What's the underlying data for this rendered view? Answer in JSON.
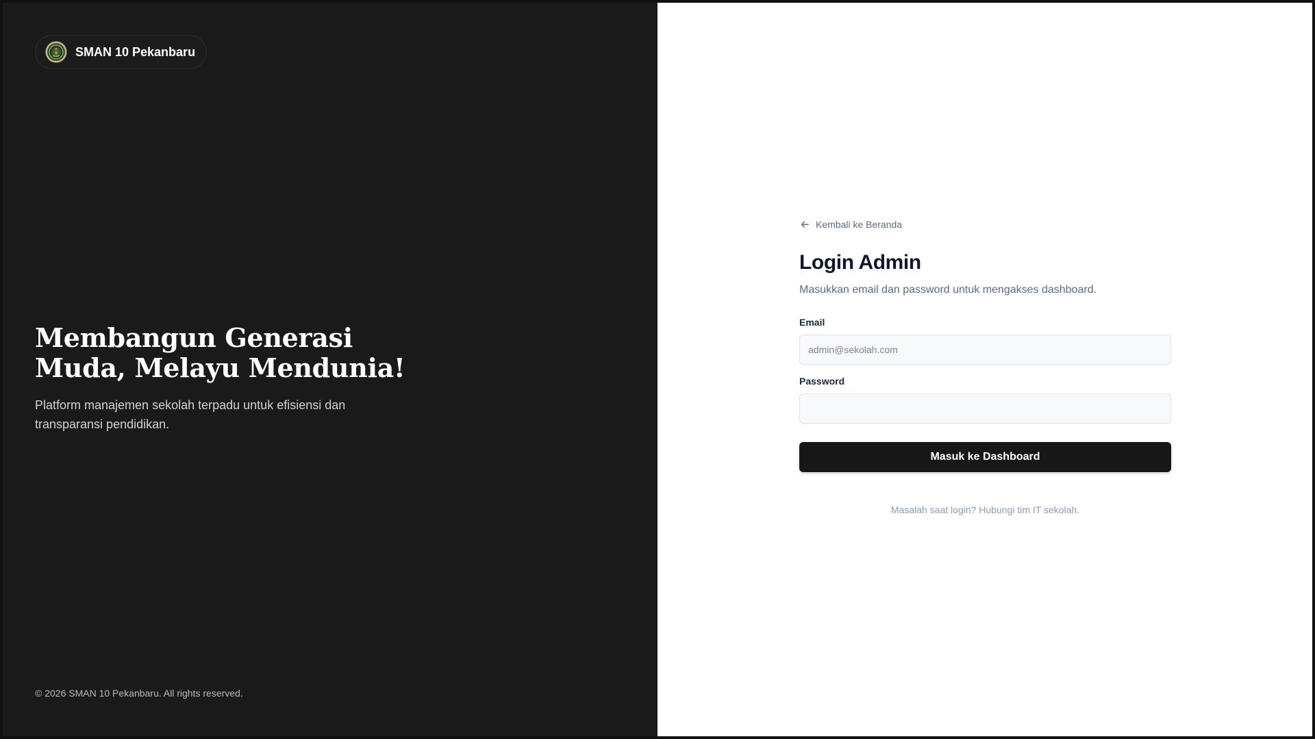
{
  "brand": {
    "name": "SMAN 10 Pekanbaru",
    "logo_icon": "school-emblem-icon"
  },
  "hero": {
    "title_line1": "Membangun Generasi",
    "title_line2": "Muda, Melayu Mendunia!",
    "subtitle": "Platform manajemen sekolah terpadu untuk efisiensi dan transparansi pendidikan."
  },
  "footer": {
    "copyright": "© 2026 SMAN 10 Pekanbaru. All rights reserved."
  },
  "login": {
    "back_link": "Kembali ke Beranda",
    "back_icon": "arrow-left-icon",
    "title": "Login Admin",
    "subtitle": "Masukkan email dan password untuk mengakses dashboard.",
    "email_label": "Email",
    "email_placeholder": "admin@sekolah.com",
    "email_value": "",
    "password_label": "Password",
    "password_placeholder": "",
    "password_value": "",
    "submit_label": "Masuk ke Dashboard",
    "help_text": "Masalah saat login? Hubungi tim IT sekolah."
  },
  "colors": {
    "left_panel_bg": "#1a1a1b",
    "right_panel_bg": "#ffffff",
    "primary_button": "#171717",
    "link_muted": "#5c6b84"
  }
}
